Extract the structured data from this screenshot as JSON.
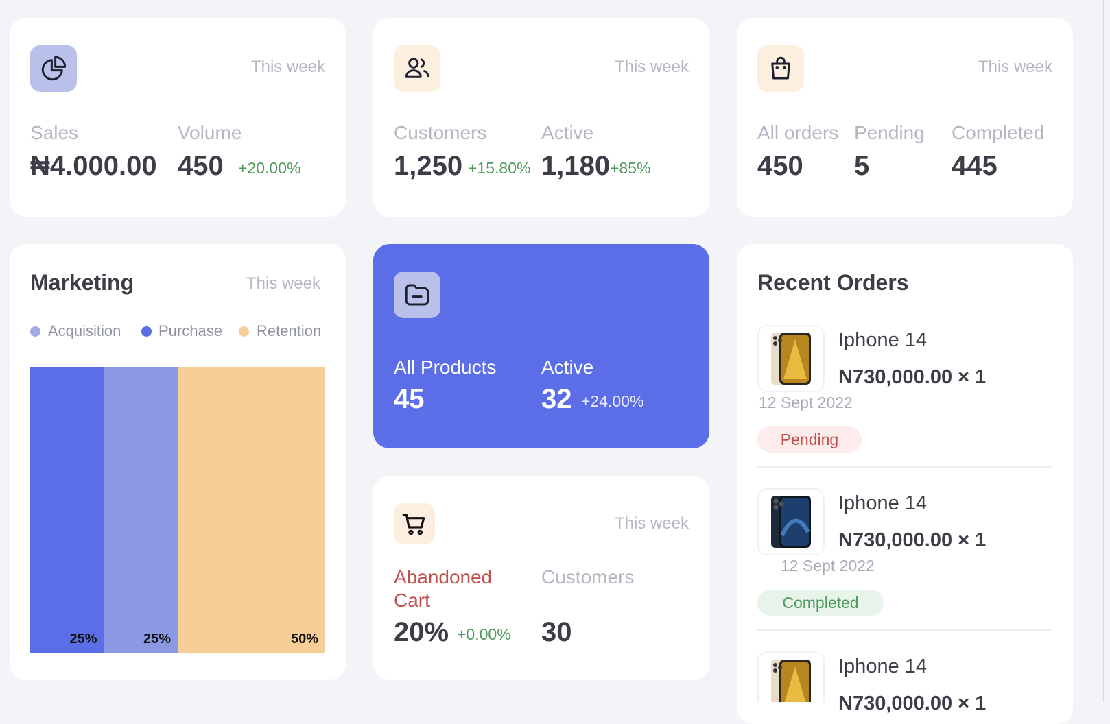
{
  "cards": {
    "sales": {
      "period": "This week",
      "sales_label": "Sales",
      "sales_value": "₦4.000.00",
      "volume_label": "Volume",
      "volume_value": "450",
      "volume_delta": "+20.00%"
    },
    "customers": {
      "period": "This week",
      "customers_label": "Customers",
      "customers_value": "1,250",
      "customers_delta": "+15.80%",
      "active_label": "Active",
      "active_value": "1,180",
      "active_delta": "+85%"
    },
    "orders": {
      "period": "This week",
      "all_label": "All orders",
      "all_value": "450",
      "pending_label": "Pending",
      "pending_value": "5",
      "completed_label": "Completed",
      "completed_value": "445"
    },
    "marketing": {
      "title": "Marketing",
      "period": "This week",
      "legend": [
        {
          "label": "Acquisition",
          "color": "#a3aae6"
        },
        {
          "label": "Purchase",
          "color": "#5b6ee8"
        },
        {
          "label": "Retention",
          "color": "#f7cd98"
        }
      ]
    },
    "products": {
      "all_label": "All Products",
      "all_value": "45",
      "active_label": "Active",
      "active_value": "32",
      "active_delta": "+24.00%"
    },
    "cart": {
      "period": "This week",
      "abandoned_label_1": "Abandoned",
      "abandoned_label_2": "Cart",
      "abandoned_value": "20%",
      "abandoned_delta": "+0.00%",
      "customers_label": "Customers",
      "customers_value": "30"
    },
    "recent_orders": {
      "title": "Recent Orders",
      "items": [
        {
          "name": "Iphone 14",
          "price": "N730,000.00 × 1",
          "date": "12 Sept 2022",
          "status": "Pending",
          "phone_color": "gold"
        },
        {
          "name": "Iphone 14",
          "price": "N730,000.00 × 1",
          "date": "12 Sept 2022",
          "status": "Completed",
          "phone_color": "blue"
        },
        {
          "name": "Iphone 14",
          "price": "N730,000.00 × 1",
          "phone_color": "gold"
        }
      ]
    }
  },
  "chart_data": {
    "type": "bar",
    "categories": [
      "Purchase",
      "Acquisition",
      "Retention"
    ],
    "values": [
      25,
      25,
      50
    ],
    "unit": "%",
    "colors": [
      "#5b6ee8",
      "#8b98e2",
      "#f7cd98"
    ],
    "labels": [
      "25%",
      "25%",
      "50%"
    ]
  }
}
